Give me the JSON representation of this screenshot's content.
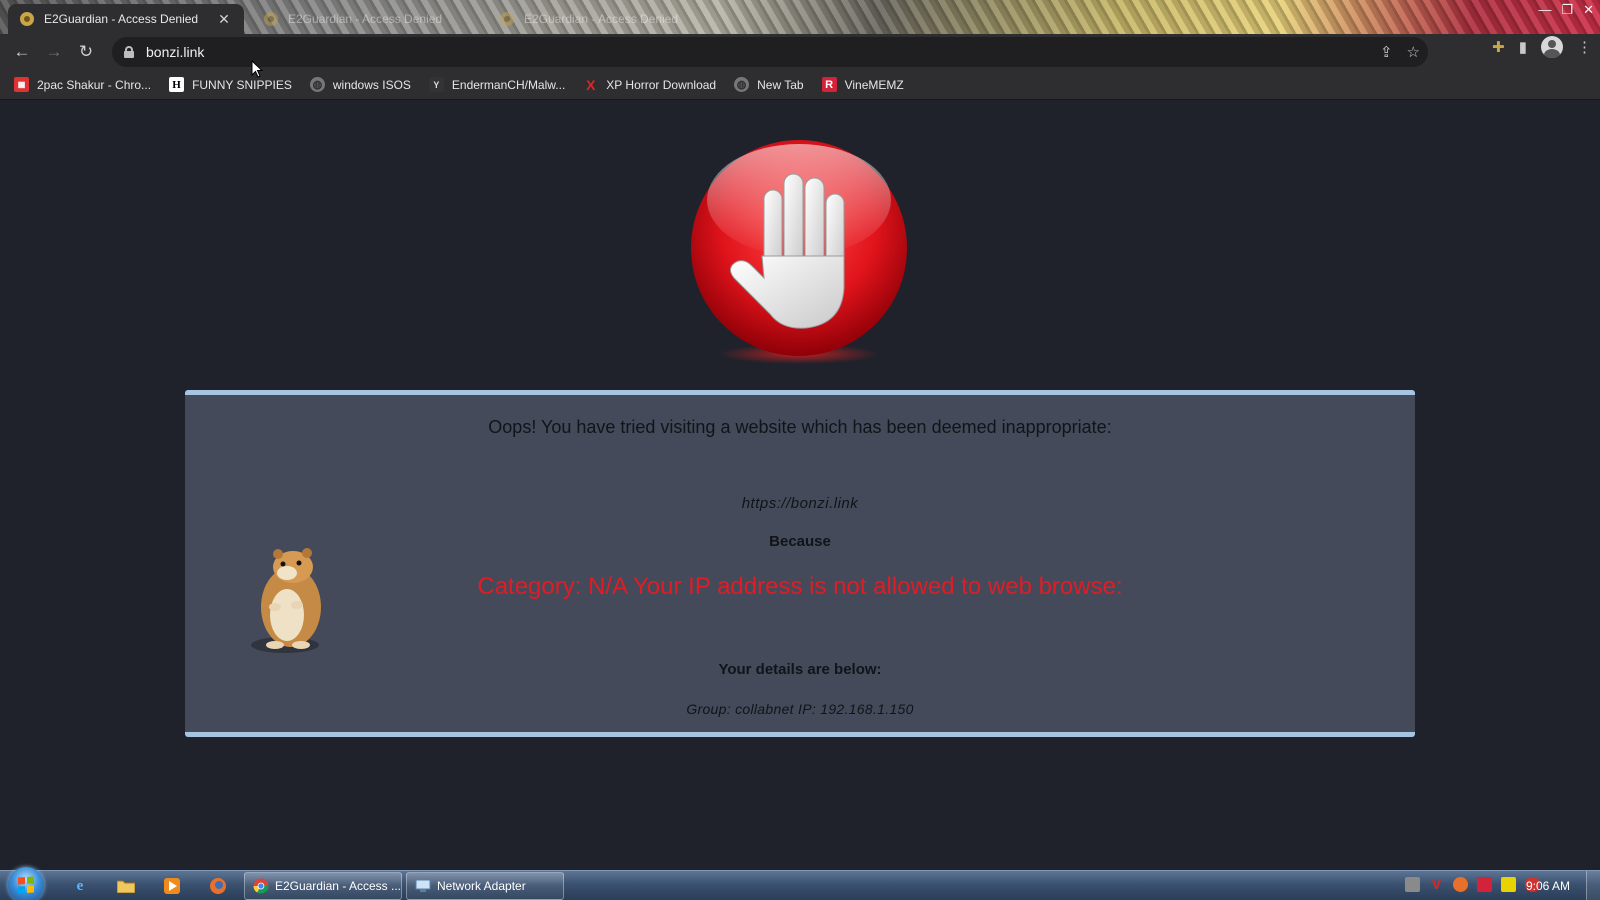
{
  "browser": {
    "tabs": [
      {
        "title": "E2Guardian - Access Denied",
        "active": true
      },
      {
        "title": "E2Guardian - Access Denied",
        "active": false
      },
      {
        "title": "E2Guardian - Access Denied",
        "active": false
      }
    ],
    "address": "bonzi.link",
    "bookmarks": [
      {
        "label": "2pac Shakur - Chro...",
        "icon": "calendar-icon"
      },
      {
        "label": "FUNNY SNIPPIES",
        "icon": "h-logo-icon"
      },
      {
        "label": "windows ISOS",
        "icon": "globe-icon"
      },
      {
        "label": "EndermanCH/Malw...",
        "icon": "ycombinator-icon"
      },
      {
        "label": "XP Horror Download",
        "icon": "x-logo-icon"
      },
      {
        "label": "New Tab",
        "icon": "globe-icon"
      },
      {
        "label": "VineMEMZ",
        "icon": "r-logo-icon"
      }
    ]
  },
  "page": {
    "oops_text": "Oops! You have tried visiting a website which has been deemed inappropriate:",
    "blocked_url": "https://bonzi.link",
    "because_label": "Because",
    "reason": "Category: N/A  Your IP address is not allowed to web browse:",
    "details_heading": "Your details are below:",
    "details_text": "Group: collabnet   IP: 192.168.1.150",
    "colors": {
      "reason": "#e01c25",
      "panel": "#444a5a",
      "panel_border": "#a6c5e3",
      "background": "#1f222b"
    }
  },
  "taskbar": {
    "buttons": [
      {
        "label": "E2Guardian - Access ...",
        "icon": "chrome-icon"
      },
      {
        "label": "Network Adapter",
        "icon": "network-icon"
      }
    ],
    "clock": "9:06 AM"
  }
}
